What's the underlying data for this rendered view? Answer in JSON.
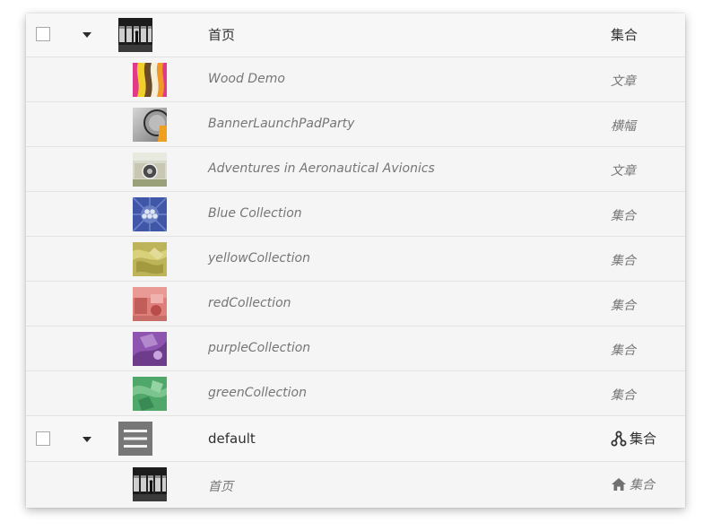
{
  "groups": [
    {
      "title": "首页",
      "type": "集合",
      "children": [
        {
          "title": "Wood Demo",
          "type": "文章"
        },
        {
          "title": "BannerLaunchPadParty",
          "type": "横幅"
        },
        {
          "title": "Adventures in Aeronautical Avionics",
          "type": "文章"
        },
        {
          "title": "Blue Collection",
          "type": "集合"
        },
        {
          "title": "yellowCollection",
          "type": "集合"
        },
        {
          "title": "redCollection",
          "type": "集合"
        },
        {
          "title": "purpleCollection",
          "type": "集合"
        },
        {
          "title": "greenCollection",
          "type": "集合"
        }
      ]
    },
    {
      "title": "default",
      "type": "集合",
      "type_icon": "branch-icon",
      "children": [
        {
          "title": "首页",
          "type": "集合",
          "type_icon": "home-icon"
        }
      ]
    }
  ]
}
